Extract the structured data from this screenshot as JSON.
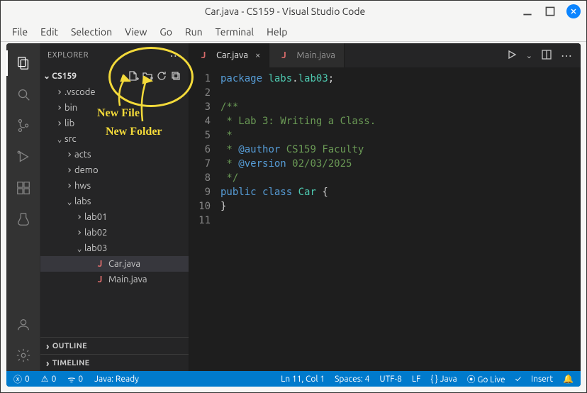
{
  "titlebar": {
    "title": "Car.java - CS159 - Visual Studio Code"
  },
  "menu": {
    "items": [
      "File",
      "Edit",
      "Selection",
      "View",
      "Go",
      "Run",
      "Terminal",
      "Help"
    ]
  },
  "sidebar": {
    "header": "EXPLORER",
    "root": "CS159",
    "tree": [
      {
        "label": ".vscode",
        "depth": 1,
        "kind": "folder",
        "open": false
      },
      {
        "label": "bin",
        "depth": 1,
        "kind": "folder",
        "open": false
      },
      {
        "label": "lib",
        "depth": 1,
        "kind": "folder",
        "open": false
      },
      {
        "label": "src",
        "depth": 1,
        "kind": "folder",
        "open": true
      },
      {
        "label": "acts",
        "depth": 2,
        "kind": "folder",
        "open": false
      },
      {
        "label": "demo",
        "depth": 2,
        "kind": "folder",
        "open": false
      },
      {
        "label": "hws",
        "depth": 2,
        "kind": "folder",
        "open": false
      },
      {
        "label": "labs",
        "depth": 2,
        "kind": "folder",
        "open": true
      },
      {
        "label": "lab01",
        "depth": 3,
        "kind": "folder",
        "open": false
      },
      {
        "label": "lab02",
        "depth": 3,
        "kind": "folder",
        "open": false
      },
      {
        "label": "lab03",
        "depth": 3,
        "kind": "folder",
        "open": true
      },
      {
        "label": "Car.java",
        "depth": 4,
        "kind": "file",
        "selected": true
      },
      {
        "label": "Main.java",
        "depth": 4,
        "kind": "file"
      }
    ],
    "outline": "OUTLINE",
    "timeline": "TIMELINE"
  },
  "tabs": [
    {
      "label": "Car.java",
      "active": true
    },
    {
      "label": "Main.java",
      "active": false
    }
  ],
  "code": {
    "lines": [
      {
        "n": 1,
        "html": "<span class='tok-kw'>package</span> <span class='tok-id'>labs</span><span class='tok-pun'>.</span><span class='tok-id'>lab03</span><span class='tok-pun'>;</span>"
      },
      {
        "n": 2,
        "html": ""
      },
      {
        "n": 3,
        "html": "<span class='tok-comm'>/**</span>"
      },
      {
        "n": 4,
        "html": "<span class='tok-comm'> * Lab 3: Writing a Class.</span>"
      },
      {
        "n": 5,
        "html": "<span class='tok-comm'> *</span>"
      },
      {
        "n": 6,
        "html": "<span class='tok-comm'> * </span><span class='tok-tag'>@author</span><span class='tok-comm'> CS159 Faculty</span>"
      },
      {
        "n": 7,
        "html": "<span class='tok-comm'> * </span><span class='tok-tag'>@version</span><span class='tok-comm'> 02/03/2025</span>"
      },
      {
        "n": 8,
        "html": "<span class='tok-comm'> */</span>"
      },
      {
        "n": 9,
        "html": "<span class='tok-kw'>public</span> <span class='tok-kw'>class</span> <span class='tok-id'>Car</span> <span class='tok-pun'>{</span>"
      },
      {
        "n": 10,
        "html": "<span class='tok-pun'>}</span>"
      },
      {
        "n": 11,
        "html": ""
      }
    ]
  },
  "status": {
    "errors": "0",
    "warnings": "0",
    "ports": "0",
    "java": "Java: Ready",
    "pos": "Ln 11, Col 1",
    "spaces": "Spaces: 4",
    "encoding": "UTF-8",
    "eol": "LF",
    "lang": "{ } Java",
    "golive": "⦿ Go Live",
    "check": "✓",
    "insert": "Insert"
  },
  "anno": {
    "newfile": "New File",
    "newfolder": "New Folder"
  }
}
